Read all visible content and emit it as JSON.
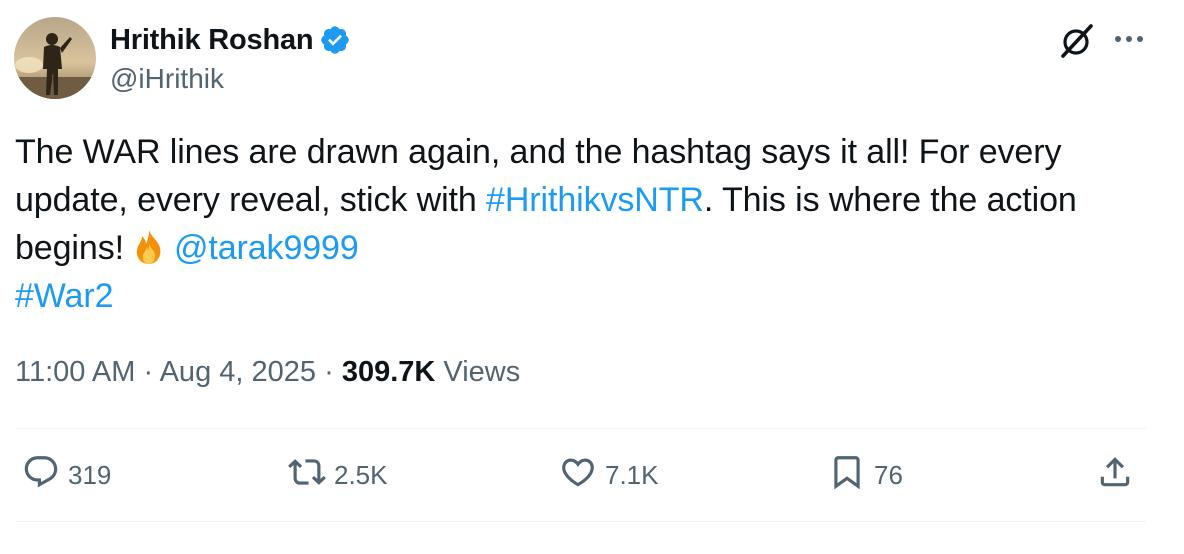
{
  "author": {
    "name": "Hrithik Roshan",
    "handle": "@iHrithik",
    "verified": true
  },
  "tweet": {
    "line1": "The WAR lines are drawn again, and the hashtag says it all! For every",
    "line2_pre": "update, every reveal, stick with ",
    "hashtag1": "#HrithikvsNTR",
    "line2_post": ". This is where the action",
    "line3_pre": "begins!",
    "mention": "@tarak9999",
    "hashtag2": "#War2"
  },
  "meta": {
    "time": "11:00 AM",
    "separator": "·",
    "date": "Aug 4, 2025",
    "views_count": "309.7K",
    "views_label": "Views"
  },
  "actions": {
    "replies": "319",
    "reposts": "2.5K",
    "likes": "7.1K",
    "bookmarks": "76"
  },
  "colors": {
    "link": "#1d9bf0",
    "secondary_text": "#536471",
    "primary_text": "#0f1419",
    "divider": "#eff3f4"
  },
  "icons": [
    "verified-badge-icon",
    "grok-icon",
    "more-options-icon",
    "reply-icon",
    "repost-icon",
    "like-icon",
    "bookmark-icon",
    "share-icon",
    "fire-emoji"
  ]
}
